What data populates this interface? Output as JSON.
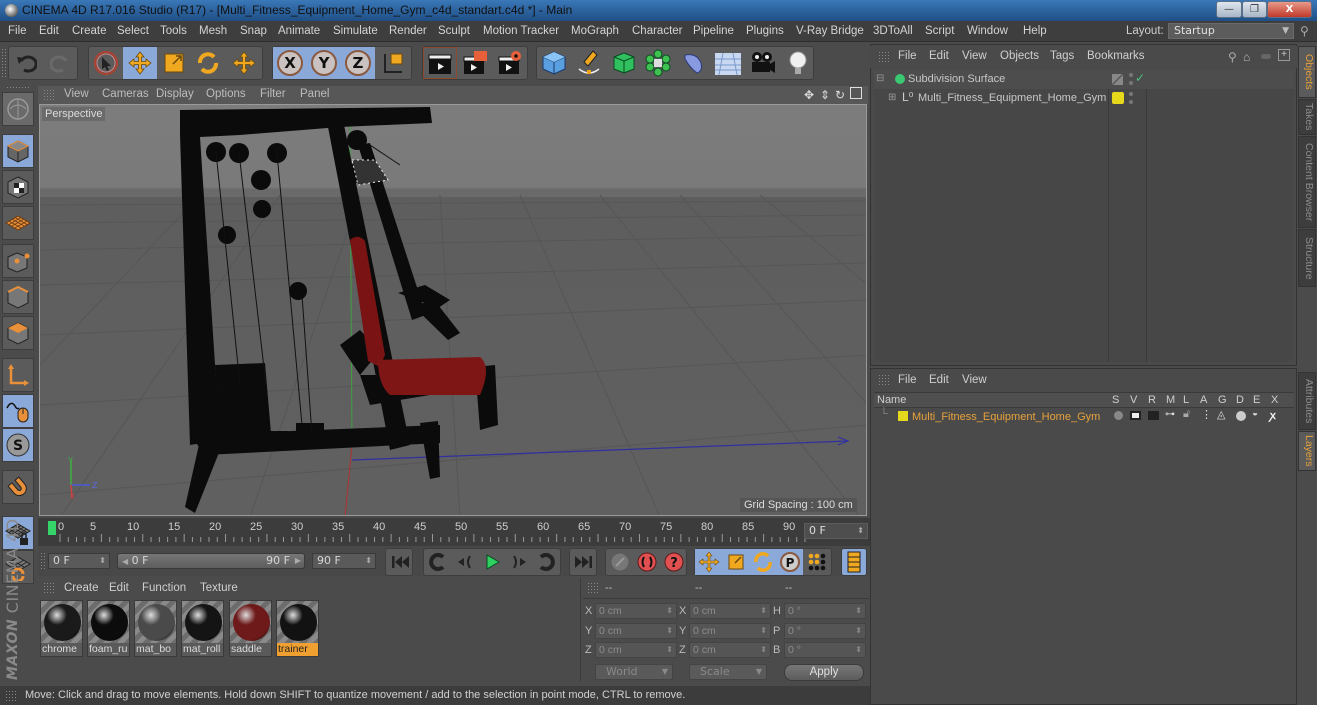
{
  "window": {
    "title": "CINEMA 4D R17.016 Studio (R17) - [Multi_Fitness_Equipment_Home_Gym_c4d_standart.c4d *] - Main",
    "controls": {
      "minimize": "—",
      "maximize": "❐",
      "close": "X"
    }
  },
  "menubar": {
    "items": [
      "File",
      "Edit",
      "Create",
      "Select",
      "Tools",
      "Mesh",
      "Snap",
      "Animate",
      "Simulate",
      "Render",
      "Sculpt",
      "Motion Tracker",
      "MoGraph",
      "Character",
      "Pipeline",
      "Plugins",
      "V-Ray Bridge",
      "3DToAll",
      "Script",
      "Window",
      "Help"
    ],
    "layout_label": "Layout:",
    "layout_value": "Startup"
  },
  "toolbar": {
    "undo": "undo-icon",
    "redo": "redo-icon",
    "tools": [
      "live-selection-icon",
      "move-icon",
      "scale-icon",
      "rotate-icon",
      "last-tool-icon"
    ],
    "axes": [
      "X",
      "Y",
      "Z"
    ],
    "coord_system": "world-coordinates-icon",
    "render": [
      "render-view-icon",
      "render-picture-viewer-icon",
      "render-settings-icon"
    ],
    "objects": [
      "cube-icon",
      "pen-spline-icon",
      "subdivision-surface-icon",
      "cloner-icon",
      "deformer-icon",
      "floor-icon",
      "camera-icon",
      "light-icon"
    ]
  },
  "viewport": {
    "menu": [
      "View",
      "Cameras",
      "Display",
      "Options",
      "Filter",
      "Panel"
    ],
    "camera_label": "Perspective",
    "grid_spacing": "Grid Spacing : 100 cm",
    "axis_labels": {
      "y": "Y",
      "z": "Z",
      "x": "X"
    },
    "nav_icons": [
      "pan-icon",
      "dolly-icon",
      "orbit-icon",
      "layout-toggle-icon"
    ]
  },
  "left_tools": [
    "make-editable-icon",
    "model-mode-icon",
    "texture-mode-icon",
    "workplane-mode-icon",
    "points-mode-icon",
    "edges-mode-icon",
    "polygons-mode-icon",
    "axis-mode-icon",
    "tweak-mode-icon",
    "soft-selection-icon",
    "snap-icon",
    "workplane-lock-icon",
    "workplane-rotate-icon"
  ],
  "timeline": {
    "ticks": [
      "0",
      "5",
      "10",
      "15",
      "20",
      "25",
      "30",
      "35",
      "40",
      "45",
      "50",
      "55",
      "60",
      "65",
      "70",
      "75",
      "80",
      "85",
      "90"
    ],
    "current_frame": "0 F"
  },
  "transport": {
    "start_field": "0 F",
    "range_start": "0 F",
    "range_end": "90 F",
    "end_field": "90 F",
    "buttons": [
      "go-to-start",
      "previous-key",
      "previous-frame",
      "play",
      "next-frame",
      "next-key",
      "go-to-end"
    ]
  },
  "material_manager": {
    "menu": [
      "Create",
      "Edit",
      "Function",
      "Texture"
    ],
    "materials": [
      {
        "name": "chrome",
        "color": "#1a1a1a",
        "selected": false
      },
      {
        "name": "foam_ru",
        "color": "#0c0c0c",
        "selected": false
      },
      {
        "name": "mat_bo",
        "color": "#4a4a4a",
        "selected": false
      },
      {
        "name": "mat_roll",
        "color": "#141414",
        "selected": false
      },
      {
        "name": "saddle",
        "color": "#6e1a1a",
        "selected": false
      },
      {
        "name": "trainer",
        "color": "#121212",
        "selected": true
      }
    ]
  },
  "coordinates": {
    "headers": [
      "--",
      "--",
      "--"
    ],
    "position": {
      "X": "0 cm",
      "Y": "0 cm",
      "Z": "0 cm"
    },
    "size": {
      "X": "0 cm",
      "Y": "0 cm",
      "Z": "0 cm"
    },
    "rotation": {
      "H": "0 °",
      "P": "0 °",
      "B": "0 °"
    },
    "space_dropdown": "World",
    "mode_dropdown": "Scale",
    "apply_label": "Apply"
  },
  "status_bar": "Move: Click and drag to move elements. Hold down SHIFT to quantize movement / add to the selection in point mode, CTRL to remove.",
  "object_manager": {
    "menu": [
      "File",
      "Edit",
      "View",
      "Objects",
      "Tags",
      "Bookmarks"
    ],
    "objects": [
      {
        "name": "Subdivision Surface",
        "icon": "subdivision-surface-icon",
        "checked": true
      },
      {
        "name": "Multi_Fitness_Equipment_Home_Gym",
        "icon": "null-object-icon",
        "layer_color": "#e6d81a"
      }
    ]
  },
  "layer_manager": {
    "menu": [
      "File",
      "Edit",
      "View"
    ],
    "columns": [
      "Name",
      "S",
      "V",
      "R",
      "M",
      "L",
      "A",
      "G",
      "D",
      "E",
      "X"
    ],
    "layers": [
      {
        "name": "Multi_Fitness_Equipment_Home_Gym",
        "color": "#e6d81a",
        "text_color": "#e8a23a"
      }
    ]
  },
  "side_tabs": {
    "top": [
      {
        "label": "Objects",
        "active": true
      },
      {
        "label": "Takes",
        "active": false
      },
      {
        "label": "Content Browser",
        "active": false
      },
      {
        "label": "Structure",
        "active": false
      }
    ],
    "bottom": [
      {
        "label": "Attributes",
        "active": false
      },
      {
        "label": "Layers",
        "active": true
      }
    ]
  },
  "colors": {
    "accent_blue": "#8aa8d8",
    "accent_orange": "#e8a23a",
    "playhead": "#35d46a"
  }
}
